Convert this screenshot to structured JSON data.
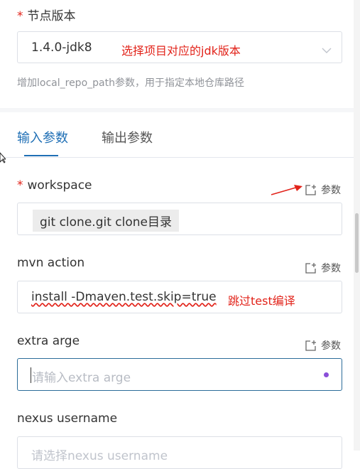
{
  "node_version": {
    "required_mark": "*",
    "label": "节点版本",
    "value": "1.4.0-jdk8",
    "annotation": "选择项目对应的jdk版本",
    "hint": "增加local_repo_path参数，用于指定本地仓库路径"
  },
  "tabs": [
    {
      "label": "输入参数",
      "active": true
    },
    {
      "label": "输出参数",
      "active": false
    }
  ],
  "params_button_label": "参数",
  "fields": {
    "workspace": {
      "required_mark": "*",
      "label": "workspace",
      "value": "git clone.git clone目录"
    },
    "mvn_action": {
      "label": "mvn action",
      "value": "install -Dmaven.test.skip=true",
      "annotation": "跳过test编译"
    },
    "extra_arge": {
      "label": "extra arge",
      "placeholder": "请输入extra arge"
    },
    "nexus_username": {
      "label": "nexus username",
      "placeholder": "请选择nexus username"
    }
  },
  "colors": {
    "accent": "#1f6fb5",
    "annotation": "#e2231a",
    "focus_border": "#2b6c99"
  }
}
